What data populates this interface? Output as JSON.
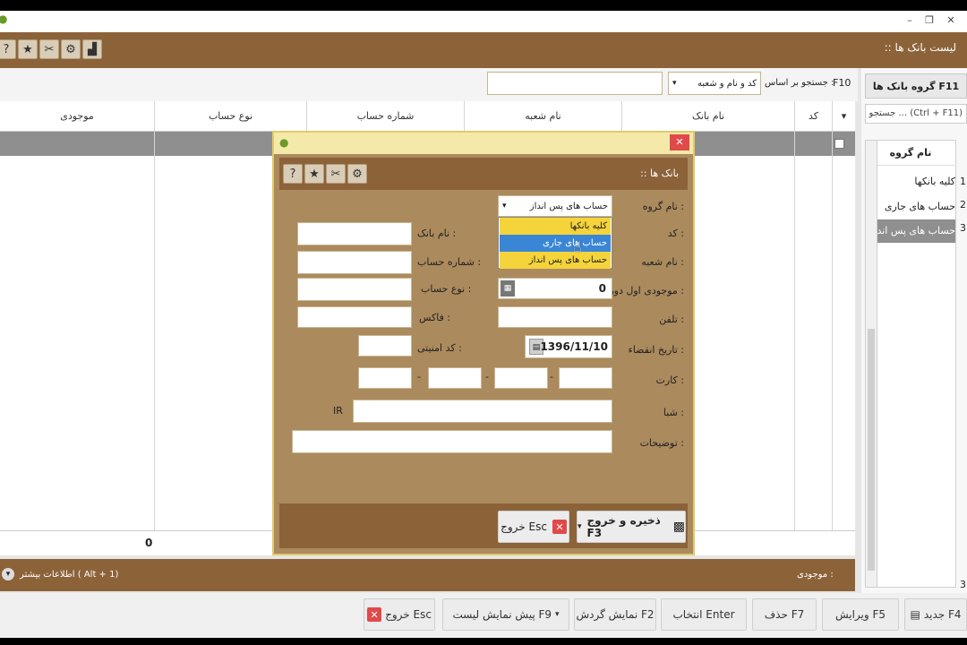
{
  "window": {
    "title": ":: لیست بانک ها",
    "min": "–",
    "max": "❐",
    "close": "✕"
  },
  "toolbar": {
    "icons": [
      "help-icon",
      "star-icon",
      "tools-icon",
      "gear-icon",
      "chart-icon"
    ]
  },
  "search": {
    "key_label": "F10",
    "by_label": "جستجو بر اساس :",
    "field_option": "کد و نام و شعبه",
    "value": ""
  },
  "grid": {
    "headers": {
      "code": "کد",
      "bank_name": "نام بانک",
      "branch_name": "نام شعبه",
      "account_number": "شماره حساب",
      "account_type": "نوع حساب",
      "balance": "موجودی"
    },
    "total_balance": "0"
  },
  "right_panel": {
    "group_button": "گروه بانک ها F11",
    "search_placeholder": "جستجو ... (Ctrl + F11)",
    "header": "نام گروه",
    "rows": [
      {
        "num": "1",
        "name": "کلیه بانکها"
      },
      {
        "num": "2",
        "name": "حساب های جاری"
      },
      {
        "num": "3",
        "name": "حساب های پس انداز"
      }
    ],
    "footer_count": "3"
  },
  "more_bar": {
    "balance_label": "موجودی :",
    "more_info": "اطلاعات بیشتر ( Alt + 1)"
  },
  "bottom_buttons": {
    "new": "جدید F4",
    "edit": "ویرایش F5",
    "delete": "حذف F7",
    "select": "انتخاب Enter",
    "turnover": "نمایش گردش F2",
    "preview": "پیش نمایش لیست F9",
    "exit": "خروج Esc"
  },
  "dialog": {
    "title": ":: بانک ها",
    "labels": {
      "group_name": "نام گروه :",
      "code": "کد :",
      "branch": "نام شعبه :",
      "opening_balance": "موجودی اول دوره :",
      "phone": "تلفن :",
      "expiry": "تاریخ انقضاء :",
      "card": "کارت :",
      "sheba": "شبا :",
      "notes": "توضیحات :",
      "bank_name": "نام بانک :",
      "account_number": "شماره حساب :",
      "account_type": "نوع حساب :",
      "fax": "فاکس :",
      "security_code": "کد امنیتی :"
    },
    "values": {
      "group": "حساب های پس انداز",
      "opening_balance": "0",
      "expiry": "1396/11/10",
      "iban_prefix": "IR",
      "dash": "-"
    },
    "dropdown_options": [
      "کلیه بانکها",
      "حساب های جاری",
      "حساب های پس انداز"
    ],
    "save_button": "ذخیره و خروج F3",
    "exit_button": "خروج Esc"
  }
}
